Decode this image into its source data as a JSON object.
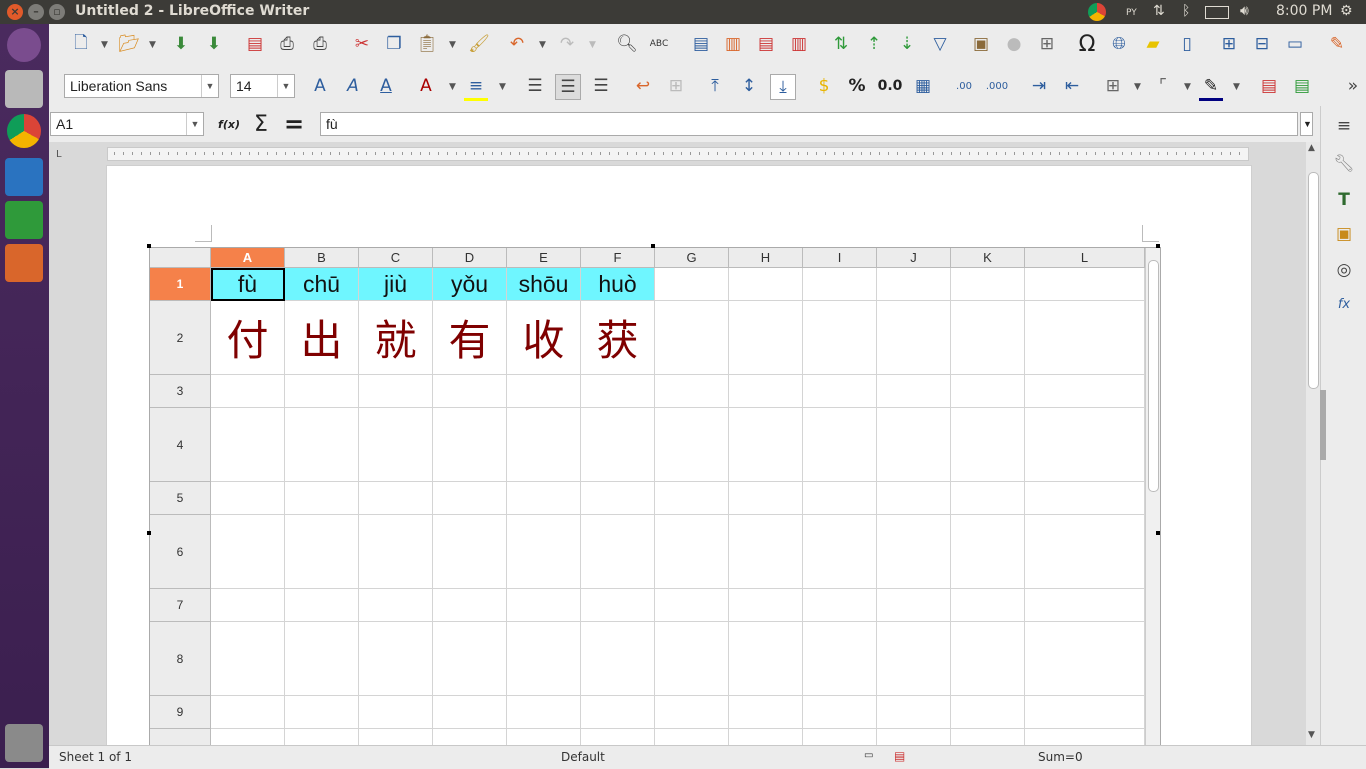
{
  "window": {
    "title": "Untitled 2 - LibreOffice Writer"
  },
  "tray": {
    "time": "8:00 PM",
    "ime": "PY"
  },
  "toolbar": {
    "font_name": "Liberation Sans",
    "font_size": "14",
    "percent_label": "%",
    "decimal_label": "0.0",
    "omega_label": "Ω"
  },
  "formula_bar": {
    "name_box": "A1",
    "fx_label": "f(x)",
    "sum_label": "Σ",
    "eq_label": "=",
    "content": "fù"
  },
  "sheet": {
    "columns": [
      "A",
      "B",
      "C",
      "D",
      "E",
      "F",
      "G",
      "H",
      "I",
      "J",
      "K",
      "L"
    ],
    "rows": [
      "1",
      "2",
      "3",
      "4",
      "5",
      "6",
      "7",
      "8",
      "9"
    ],
    "pinyin": [
      "fù",
      "chū",
      "jiù",
      "yǒu",
      "shōu",
      "huò"
    ],
    "hanzi": [
      "付",
      "出",
      "就",
      "有",
      "收",
      "获"
    ],
    "selected_cell": "A1"
  },
  "status": {
    "sheet": "Sheet 1 of 1",
    "style": "Default",
    "sum": "Sum=0"
  },
  "colors": {
    "pinyin_bg": "#6ff6ff",
    "hanzi_color": "#7f0000",
    "selection": "#f5814a"
  }
}
